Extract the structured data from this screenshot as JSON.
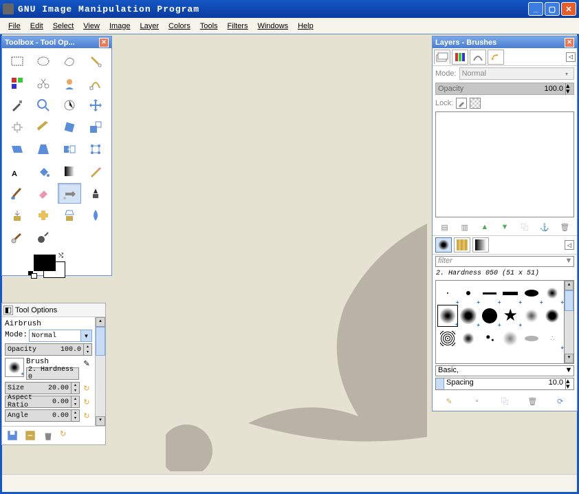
{
  "window": {
    "title": "GNU Image Manipulation Program"
  },
  "menu": {
    "items": [
      "File",
      "Edit",
      "Select",
      "View",
      "Image",
      "Layer",
      "Colors",
      "Tools",
      "Filters",
      "Windows",
      "Help"
    ]
  },
  "toolbox": {
    "title": "Toolbox - Tool Op..."
  },
  "tool_options": {
    "title": "Tool Options",
    "tool_name": "Airbrush",
    "mode_label": "Mode:",
    "mode_value": "Normal",
    "opacity_label": "Opacity",
    "opacity_value": "100.0",
    "brush_label": "Brush",
    "brush_value": "2. Hardness 0",
    "size_label": "Size",
    "size_value": "20.00",
    "aspect_label": "Aspect Ratio",
    "aspect_value": "0.00",
    "angle_label": "Angle",
    "angle_value": "0.00"
  },
  "layers_panel": {
    "title": "Layers - Brushes",
    "mode_label": "Mode:",
    "mode_value": "Normal",
    "opacity_label": "Opacity",
    "opacity_value": "100.0",
    "lock_label": "Lock:"
  },
  "brushes_panel": {
    "filter_placeholder": "filter",
    "selected_brush": "2. Hardness 050 (51 x 51)",
    "preset_value": "Basic,",
    "spacing_label": "Spacing",
    "spacing_value": "10.0"
  }
}
